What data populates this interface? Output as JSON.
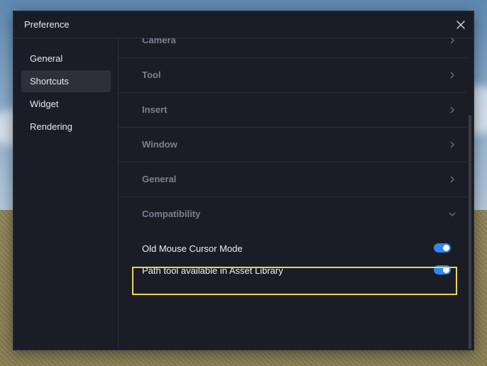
{
  "dialog": {
    "title": "Preference",
    "close_icon": "close-icon"
  },
  "sidebar": {
    "items": [
      {
        "label": "General",
        "active": false
      },
      {
        "label": "Shortcuts",
        "active": true
      },
      {
        "label": "Widget",
        "active": false
      },
      {
        "label": "Rendering",
        "active": false
      }
    ]
  },
  "sections": [
    {
      "label": "Camera",
      "state": "collapsed",
      "icon": "chevron-right-icon"
    },
    {
      "label": "Tool",
      "state": "collapsed",
      "icon": "chevron-right-icon"
    },
    {
      "label": "Insert",
      "state": "collapsed",
      "icon": "chevron-right-icon"
    },
    {
      "label": "Window",
      "state": "collapsed",
      "icon": "chevron-right-icon"
    },
    {
      "label": "General",
      "state": "collapsed",
      "icon": "chevron-right-icon"
    },
    {
      "label": "Compatibility",
      "state": "expanded",
      "icon": "chevron-down-icon"
    }
  ],
  "compatibility": {
    "settings": [
      {
        "label": "Old Mouse Cursor Mode",
        "enabled": true
      },
      {
        "label": "Path tool available in Asset Library",
        "enabled": true,
        "highlighted": true
      }
    ]
  },
  "colors": {
    "accent": "#2e86f0",
    "highlight": "#e7d74b",
    "panel": "#1b1d26"
  }
}
